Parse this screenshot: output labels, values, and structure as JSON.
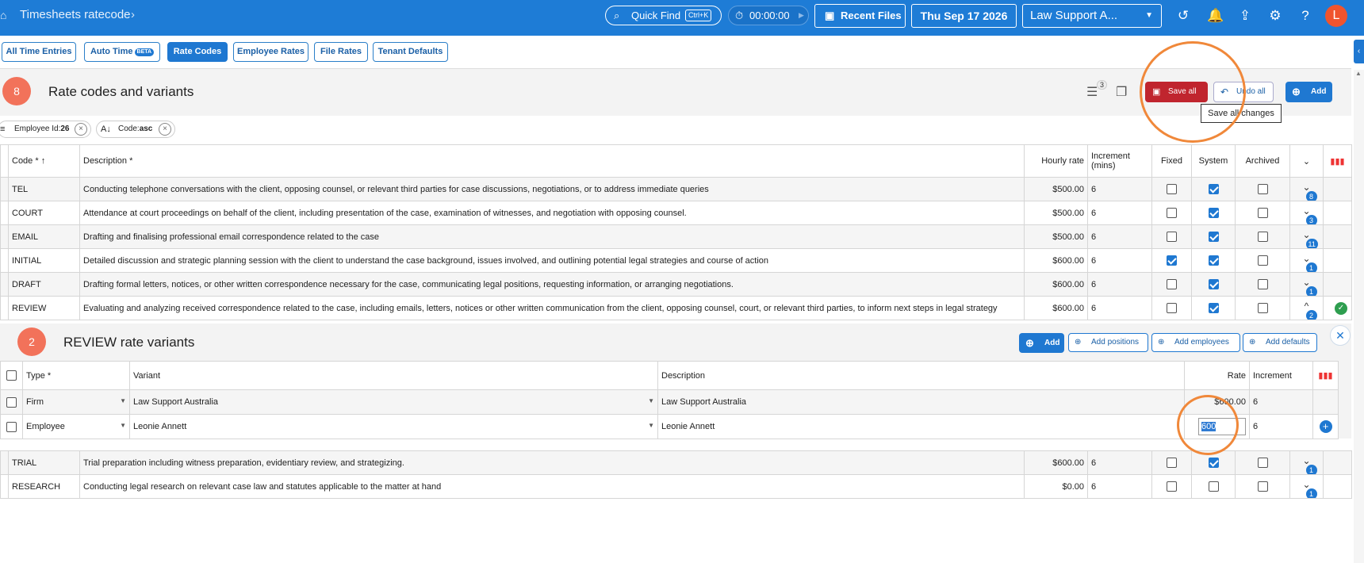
{
  "topbar": {
    "title": "Timesheets ratecode",
    "quick_find": "Quick Find",
    "quick_find_kbd": "Ctrl+K",
    "timer": "00:00:00",
    "recent_files": "Recent Files",
    "date": "Thu Sep 17 2026",
    "tenant": "Law Support A...",
    "avatar_letter": "L"
  },
  "tabs": [
    {
      "label": "All Time Entries"
    },
    {
      "label": "Auto Time",
      "badge": "BETA"
    },
    {
      "label": "Rate Codes"
    },
    {
      "label": "Employee Rates"
    },
    {
      "label": "File Rates"
    },
    {
      "label": "Tenant Defaults"
    }
  ],
  "panel": {
    "count": "8",
    "title": "Rate codes and variants",
    "filter_count": "3",
    "save_all": "Save all",
    "undo_all": "Undo all",
    "add": "Add",
    "tooltip": "Save all changes"
  },
  "chips": [
    {
      "label": "Employee Id:",
      "value": "26"
    },
    {
      "label": "Code:",
      "value": "asc"
    }
  ],
  "columns": {
    "code": "Code *",
    "description": "Description *",
    "hourly_rate": "Hourly rate",
    "increment_1": "Increment",
    "increment_2": "(mins)",
    "fixed": "Fixed",
    "system": "System",
    "archived": "Archived"
  },
  "rows": [
    {
      "code": "TEL",
      "description": "Conducting telephone conversations with the client, opposing counsel, or relevant third parties for case discussions, negotiations, or to address immediate queries",
      "rate": "$500.00",
      "increment": "6",
      "fixed": false,
      "system": true,
      "archived": false,
      "variants": "8"
    },
    {
      "code": "COURT",
      "description": "Attendance at court proceedings on behalf of the client, including presentation of the case, examination of witnesses, and negotiation with opposing counsel.",
      "rate": "$500.00",
      "increment": "6",
      "fixed": false,
      "system": true,
      "archived": false,
      "variants": "3"
    },
    {
      "code": "EMAIL",
      "description": "Drafting and finalising professional email correspondence related to the case",
      "rate": "$500.00",
      "increment": "6",
      "fixed": false,
      "system": true,
      "archived": false,
      "variants": "11"
    },
    {
      "code": "INITIAL",
      "description": "Detailed discussion and strategic planning session with the client to understand the case background, issues involved, and outlining potential legal strategies and course of action",
      "rate": "$600.00",
      "increment": "6",
      "fixed": true,
      "system": true,
      "archived": false,
      "variants": "1"
    },
    {
      "code": "DRAFT",
      "description": "Drafting formal letters, notices, or other written correspondence necessary for the case, communicating legal positions, requesting information, or arranging negotiations.",
      "rate": "$600.00",
      "increment": "6",
      "fixed": false,
      "system": true,
      "archived": false,
      "variants": "1"
    },
    {
      "code": "REVIEW",
      "description": "Evaluating and analyzing received correspondence related to the case, including emails, letters, notices or other written communication from the client, opposing counsel, court, or relevant third parties, to inform next steps in legal strategy",
      "rate": "$600.00",
      "increment": "6",
      "fixed": false,
      "system": true,
      "archived": false,
      "variants": "2"
    }
  ],
  "rows_after": [
    {
      "code": "TRIAL",
      "description": "Trial preparation including witness preparation, evidentiary review, and strategizing.",
      "rate": "$600.00",
      "increment": "6",
      "fixed": false,
      "system": true,
      "archived": false,
      "variants": "1"
    },
    {
      "code": "RESEARCH",
      "description": "Conducting legal research on relevant case law and statutes applicable to the matter at hand",
      "rate": "$0.00",
      "increment": "6",
      "fixed": false,
      "system": false,
      "archived": false,
      "variants": "1"
    }
  ],
  "variants_panel": {
    "count": "2",
    "title": "REVIEW rate variants",
    "add": "Add",
    "add_positions": "Add positions",
    "add_employees": "Add employees",
    "add_defaults": "Add defaults",
    "columns": {
      "type": "Type *",
      "variant": "Variant",
      "description": "Description",
      "rate": "Rate",
      "increment": "Increment"
    },
    "rows": [
      {
        "type": "Firm",
        "variant": "Law Support Australia",
        "description": "Law Support Australia",
        "rate": "$600.00",
        "increment": "6"
      },
      {
        "type": "Employee",
        "variant": "Leonie Annett",
        "description": "Leonie Annett",
        "rate": "600",
        "increment": "6"
      }
    ]
  },
  "colors": {
    "brand": "#1e7cd6",
    "save": "#c0252e",
    "highlight": "#f0883a"
  }
}
